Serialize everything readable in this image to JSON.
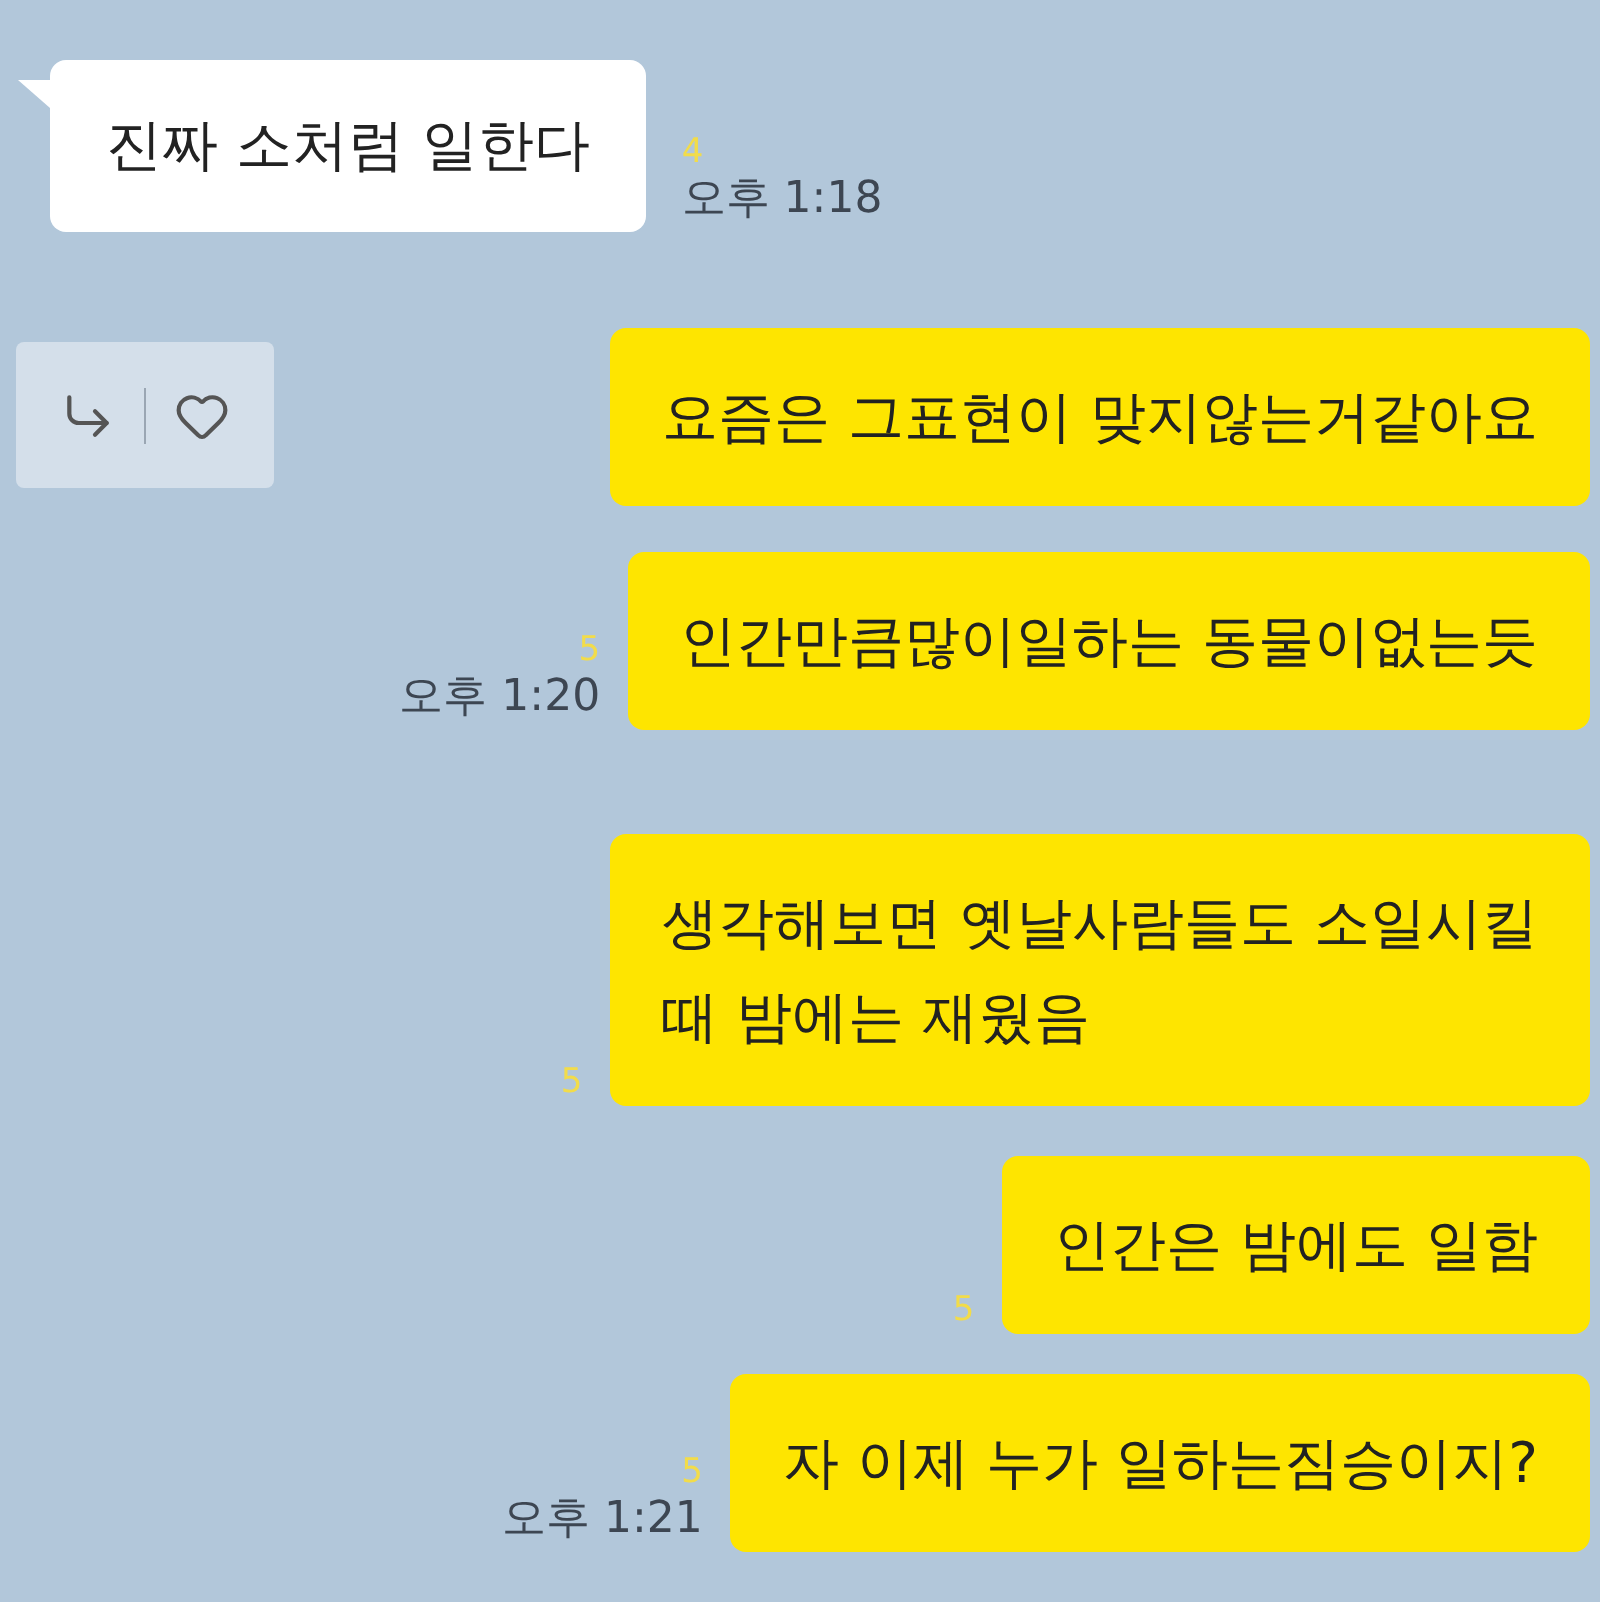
{
  "messages": [
    {
      "kind": "incoming",
      "text": "진짜 소처럼 일한다",
      "unread": "4",
      "time": "오후 1:18"
    },
    {
      "kind": "outgoing",
      "text": "요즘은 그표현이 맞지않는거같아요",
      "reaction_bar": true
    },
    {
      "kind": "outgoing",
      "text": "인간만큼많이일하는 동물이없는듯",
      "unread": "5",
      "time": "오후 1:20"
    },
    {
      "kind": "outgoing",
      "text": "생각해보면 옛날사람들도 소일시킬\n때 밤에는 재웠음",
      "unread": "5"
    },
    {
      "kind": "outgoing",
      "text": "인간은 밤에도 일함",
      "unread": "5"
    },
    {
      "kind": "outgoing",
      "text": "자 이제 누가 일하는짐승이지?",
      "unread": "5",
      "time": "오후 1:21"
    }
  ]
}
